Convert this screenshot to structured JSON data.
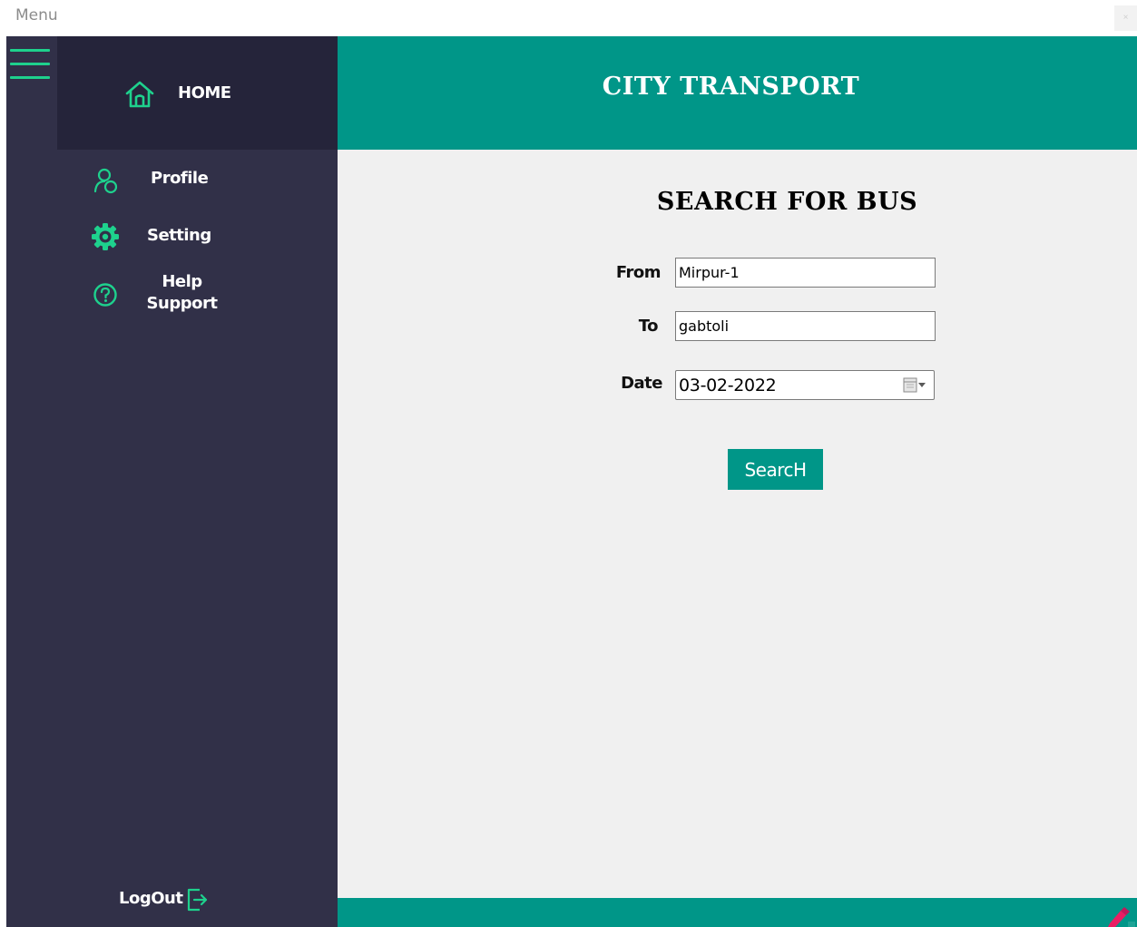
{
  "window": {
    "title": "Menu",
    "close_icon": "close-icon",
    "close_glyph": "×"
  },
  "header": {
    "title": "CITY TRANSPORT"
  },
  "sidebar": {
    "menu_icon": "hamburger-menu-icon",
    "home": {
      "label": "HOME",
      "icon": "home-icon"
    },
    "items": [
      {
        "label": "Profile",
        "icon": "profile-icon"
      },
      {
        "label": "Setting",
        "icon": "gear-icon"
      },
      {
        "label_line1": "Help",
        "label_line2": "Support",
        "icon": "help-circle-icon"
      }
    ],
    "logout": {
      "label": "LogOut",
      "icon": "logout-icon"
    }
  },
  "search": {
    "title": "SEARCH FOR BUS",
    "from_label": "From",
    "from_value": "Mirpur-1",
    "to_label": "To",
    "to_value": "gabtoli",
    "date_label": "Date",
    "date_value": "03-02-2022",
    "button_label": "SearcH"
  },
  "colors": {
    "accent": "#009688",
    "icon_green": "#1ed18d",
    "sidebar_bg": "#313048",
    "sidebar_home_bg": "#25243a",
    "content_bg": "#f0f0f0"
  }
}
